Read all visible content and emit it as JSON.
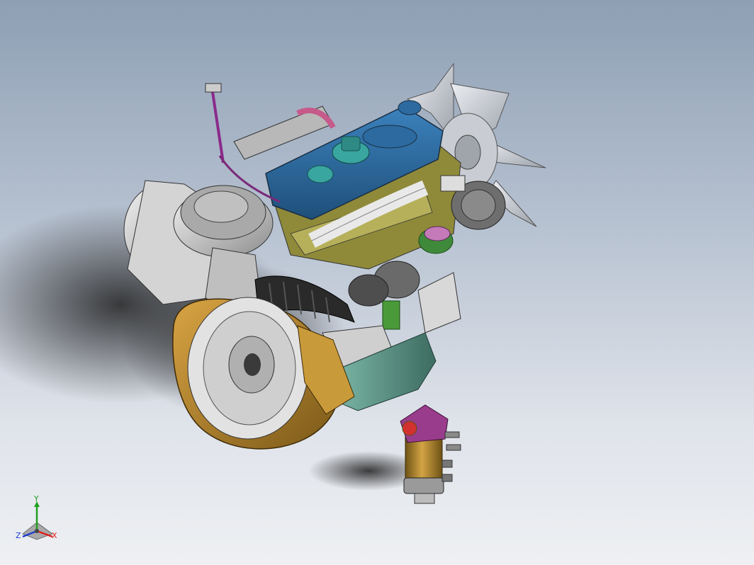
{
  "viewport": {
    "background_top": "#8e9fb4",
    "background_bottom": "#eef0f3"
  },
  "model": {
    "colors": {
      "valve_cover": "#2f6ea5",
      "bellhousing": "#b8862f",
      "oil_pan": "#5f9c8c",
      "intake_hose": "#2a2a2a",
      "filler_cap": "#3aa6a0",
      "filter_body": "#b58a2a",
      "filter_head": "#9a3c8c",
      "fan": "#d0d3d8",
      "air_cleaner": "#c8c8c8",
      "shadow": "#1e1e1e"
    }
  },
  "triad": {
    "x_label": "X",
    "y_label": "Y",
    "z_label": "Z",
    "x_color": "#e02020",
    "y_color": "#20a020",
    "z_color": "#2040d0"
  }
}
